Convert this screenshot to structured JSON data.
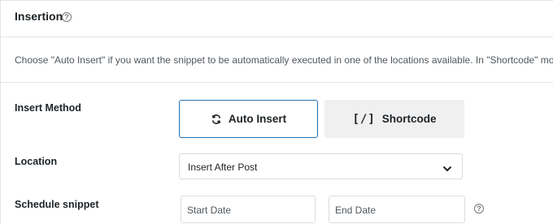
{
  "header": {
    "title": "Insertion",
    "help_icon": "question-circle-icon"
  },
  "description": "Choose \"Auto Insert\" if you want the snippet to be automatically executed in one of the locations available. In \"Shortcode\" mode, the",
  "insert_method": {
    "label": "Insert Method",
    "options": [
      {
        "label": "Auto Insert",
        "icon": "refresh-icon",
        "selected": true
      },
      {
        "label": "Shortcode",
        "icon": "shortcode-brackets-icon",
        "selected": false
      }
    ],
    "shortcode_glyph": "[/]"
  },
  "location": {
    "label": "Location",
    "value": "Insert After Post",
    "icon": "chevron-down-icon"
  },
  "schedule": {
    "label": "Schedule snippet",
    "start_placeholder": "Start Date",
    "end_placeholder": "End Date",
    "help_icon": "question-circle-icon"
  },
  "colors": {
    "accent": "#2271b1",
    "border": "#dcdcde",
    "muted_bg": "#f0f0f1"
  }
}
